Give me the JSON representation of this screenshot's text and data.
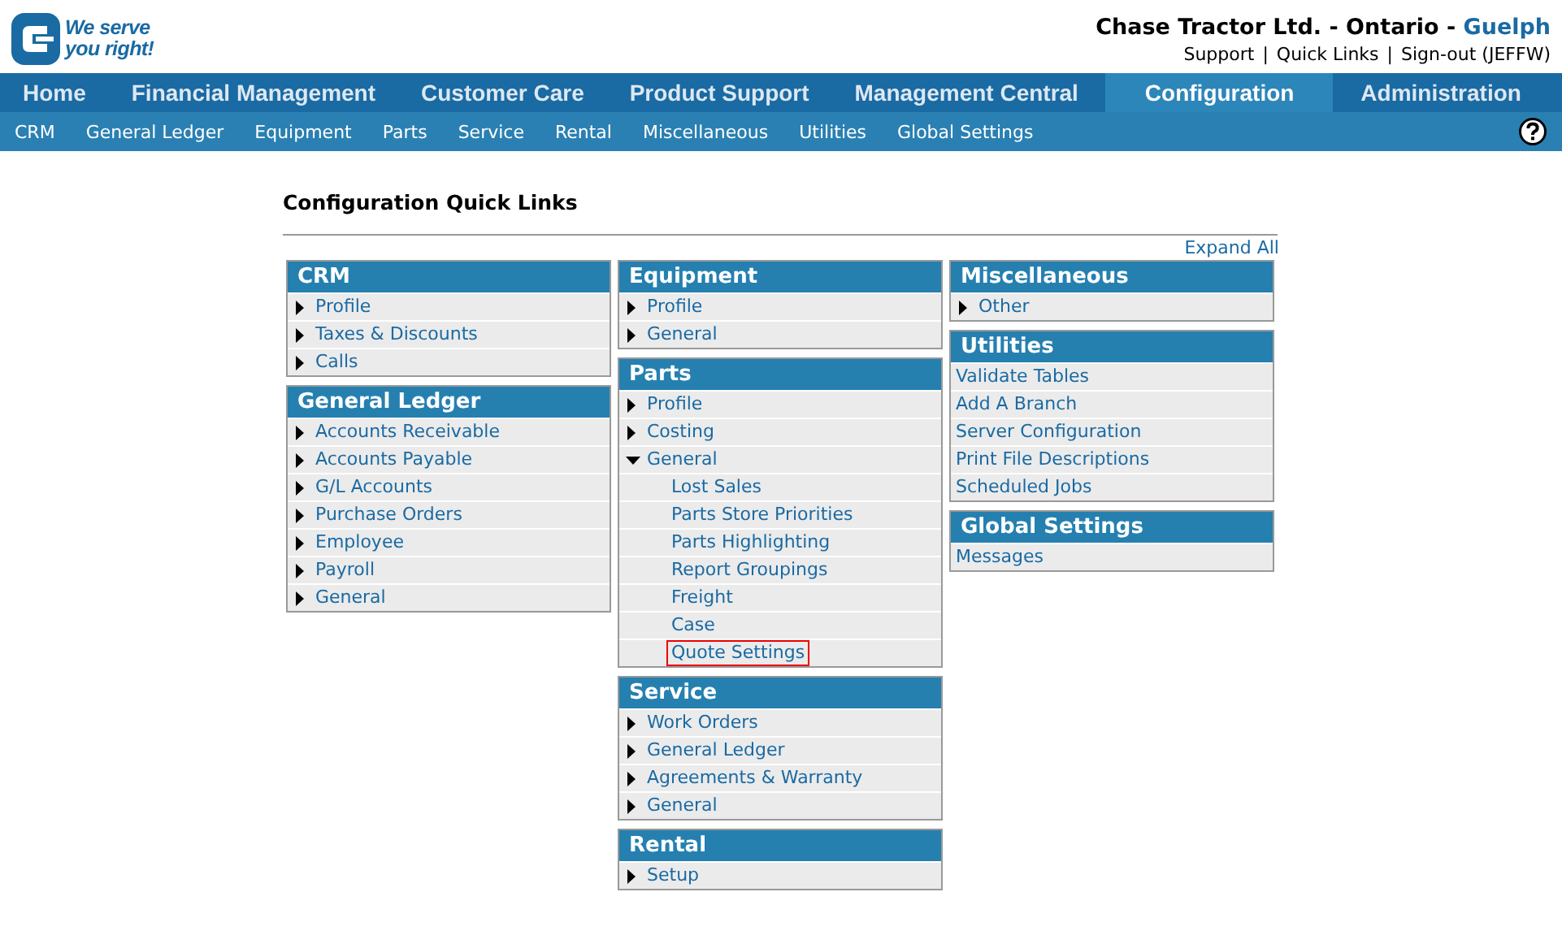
{
  "logo": {
    "tagline_1": "We serve",
    "tagline_2": "you right!"
  },
  "company": {
    "name": "Chase Tractor Ltd. - Ontario - ",
    "branch": "Guelph"
  },
  "top_links": [
    "Support",
    "Quick Links",
    "Sign-out (JEFFW)"
  ],
  "link_separator": "|",
  "main_nav": [
    {
      "label": "Home",
      "selected": false
    },
    {
      "label": "Financial Management",
      "selected": false
    },
    {
      "label": "Customer Care",
      "selected": false
    },
    {
      "label": "Product Support",
      "selected": false
    },
    {
      "label": "Management Central",
      "selected": false
    },
    {
      "label": "Configuration",
      "selected": true
    },
    {
      "label": "Administration",
      "selected": false
    }
  ],
  "sub_nav": [
    "CRM",
    "General Ledger",
    "Equipment",
    "Parts",
    "Service",
    "Rental",
    "Miscellaneous",
    "Utilities",
    "Global Settings"
  ],
  "page_title": "Configuration Quick Links",
  "expand_all": "Expand All",
  "columns": [
    [
      {
        "title": "CRM",
        "items": [
          {
            "label": "Profile",
            "kind": "collapsed",
            "highlighted": false
          },
          {
            "label": "Taxes & Discounts",
            "kind": "collapsed",
            "highlighted": false
          },
          {
            "label": "Calls",
            "kind": "collapsed",
            "highlighted": false
          }
        ]
      },
      {
        "title": "General Ledger",
        "items": [
          {
            "label": "Accounts Receivable",
            "kind": "collapsed",
            "highlighted": false
          },
          {
            "label": "Accounts Payable",
            "kind": "collapsed",
            "highlighted": false
          },
          {
            "label": "G/L Accounts",
            "kind": "collapsed",
            "highlighted": false
          },
          {
            "label": "Purchase Orders",
            "kind": "collapsed",
            "highlighted": false
          },
          {
            "label": "Employee",
            "kind": "collapsed",
            "highlighted": false
          },
          {
            "label": "Payroll",
            "kind": "collapsed",
            "highlighted": false
          },
          {
            "label": "General",
            "kind": "collapsed",
            "highlighted": false
          }
        ]
      }
    ],
    [
      {
        "title": "Equipment",
        "items": [
          {
            "label": "Profile",
            "kind": "collapsed",
            "highlighted": false
          },
          {
            "label": "General",
            "kind": "collapsed",
            "highlighted": false
          }
        ]
      },
      {
        "title": "Parts",
        "items": [
          {
            "label": "Profile",
            "kind": "collapsed",
            "highlighted": false
          },
          {
            "label": "Costing",
            "kind": "collapsed",
            "highlighted": false
          },
          {
            "label": "General",
            "kind": "expanded",
            "highlighted": false
          },
          {
            "label": "Lost Sales",
            "kind": "sub",
            "highlighted": false
          },
          {
            "label": "Parts Store Priorities",
            "kind": "sub",
            "highlighted": false
          },
          {
            "label": "Parts Highlighting",
            "kind": "sub",
            "highlighted": false
          },
          {
            "label": "Report Groupings",
            "kind": "sub",
            "highlighted": false
          },
          {
            "label": "Freight",
            "kind": "sub",
            "highlighted": false
          },
          {
            "label": "Case",
            "kind": "sub",
            "highlighted": false
          },
          {
            "label": "Quote Settings",
            "kind": "sub",
            "highlighted": true
          }
        ]
      },
      {
        "title": "Service",
        "items": [
          {
            "label": "Work Orders",
            "kind": "collapsed",
            "highlighted": false
          },
          {
            "label": "General Ledger",
            "kind": "collapsed",
            "highlighted": false
          },
          {
            "label": "Agreements & Warranty",
            "kind": "collapsed",
            "highlighted": false
          },
          {
            "label": "General",
            "kind": "collapsed",
            "highlighted": false
          }
        ]
      },
      {
        "title": "Rental",
        "items": [
          {
            "label": "Setup",
            "kind": "collapsed",
            "highlighted": false
          }
        ]
      }
    ],
    [
      {
        "title": "Miscellaneous",
        "items": [
          {
            "label": "Other",
            "kind": "collapsed",
            "highlighted": false
          }
        ]
      },
      {
        "title": "Utilities",
        "items": [
          {
            "label": "Validate Tables",
            "kind": "plain",
            "highlighted": false
          },
          {
            "label": "Add A Branch",
            "kind": "plain",
            "highlighted": false
          },
          {
            "label": "Server Configuration",
            "kind": "plain",
            "highlighted": false
          },
          {
            "label": "Print File Descriptions",
            "kind": "plain",
            "highlighted": false
          },
          {
            "label": "Scheduled Jobs",
            "kind": "plain",
            "highlighted": false
          }
        ]
      },
      {
        "title": "Global Settings",
        "items": [
          {
            "label": "Messages",
            "kind": "plain",
            "highlighted": false
          }
        ]
      }
    ]
  ]
}
